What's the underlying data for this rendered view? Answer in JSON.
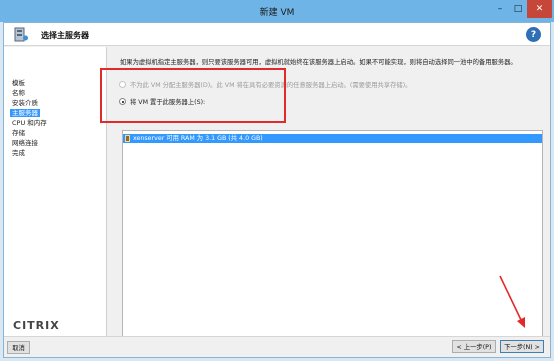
{
  "window": {
    "title": "新建 VM",
    "minimize": "–",
    "maximize": "□",
    "close": "✕"
  },
  "header": {
    "title": "选择主服务器",
    "help": "?"
  },
  "sidebar": {
    "items": [
      "模板",
      "名称",
      "安装介质",
      "主服务器",
      "CPU 和内存",
      "存储",
      "网络连接",
      "完成"
    ],
    "active_index": 3,
    "logo": "CITRIX"
  },
  "main": {
    "description": "如果为虚拟机指定主服务器，则只要该服务器可用，虚拟机就始终在该服务器上启动。如果不可能实现，则将自动选择同一池中的备用服务器。",
    "option_no_home": "不为此 VM 分配主服务器(D)。此 VM 将在具有必要资源的任意服务器上启动。(需要使用共享存储)。",
    "option_place": "将 VM 置于此服务器上(S):",
    "servers": [
      {
        "label": "xenserver  可用 RAM 为 3.1 GB (共 4.0 GB)",
        "selected": true
      }
    ]
  },
  "footer": {
    "cancel": "取消",
    "prev": "< 上一步(P)",
    "next": "下一步(N) >"
  },
  "colors": {
    "titlebar": "#6fb4e6",
    "selection": "#3399ff",
    "annotation": "#e12a2a"
  }
}
